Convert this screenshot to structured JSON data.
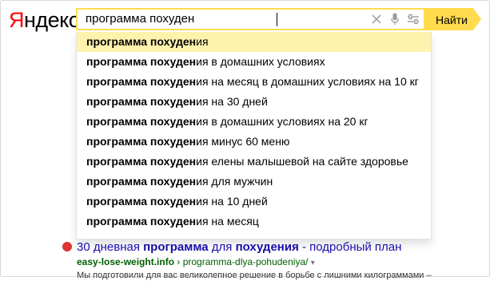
{
  "logo": {
    "first_letter": "Я",
    "rest": "ндекс"
  },
  "search": {
    "query": "программа похуден",
    "button_label": "Найти",
    "icons": [
      "clear-icon",
      "microphone-icon",
      "settings-sliders-icon"
    ]
  },
  "suggestions": [
    {
      "bold": "программа похуден",
      "rest": "ия"
    },
    {
      "bold": "программа похуден",
      "rest": "ия в домашних условиях"
    },
    {
      "bold": "программа похуден",
      "rest": "ия на месяц в домашних условиях на 10 кг"
    },
    {
      "bold": "программа похуден",
      "rest": "ия на 30 дней"
    },
    {
      "bold": "программа похуден",
      "rest": "ия в домашних условиях на 20 кг"
    },
    {
      "bold": "программа похуден",
      "rest": "ия минус 60 меню"
    },
    {
      "bold": "программа похуден",
      "rest": "ия елены малышевой на сайте здоровье"
    },
    {
      "bold": "программа похуден",
      "rest": "ия для мужчин"
    },
    {
      "bold": "программа похуден",
      "rest": "ия на 10 дней"
    },
    {
      "bold": "программа похуден",
      "rest": "ия на месяц"
    }
  ],
  "result": {
    "title_pre": "30 дневная ",
    "title_b1": "программа",
    "title_mid": " для ",
    "title_b2": "похудения",
    "title_post": " - подробный план",
    "url_domain": "easy-lose-weight.info",
    "url_sep": " › ",
    "url_path": "programma-dlya-pohudeniya/",
    "url_arrow": "▾",
    "snippet": "Мы подготовили для вас великолепное решение в борьбе с лишними килограммами –"
  },
  "colors": {
    "accent": "#ffdb4d",
    "highlight": "#fff2ad",
    "logo_red": "#ff0000",
    "link": "#1a0dab",
    "url": "#006000"
  }
}
